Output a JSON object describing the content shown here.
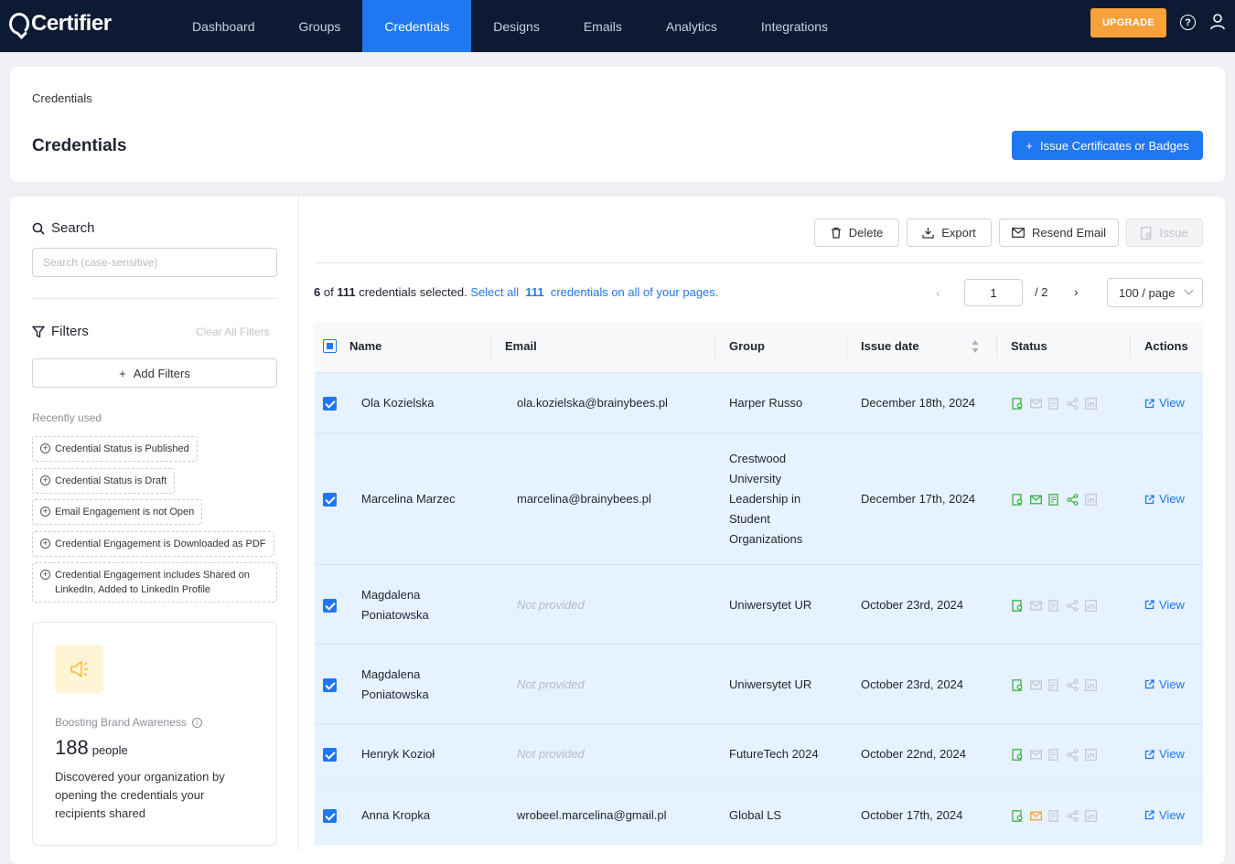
{
  "app": {
    "name": "Certifier"
  },
  "nav": {
    "items": [
      "Dashboard",
      "Groups",
      "Credentials",
      "Designs",
      "Emails",
      "Analytics",
      "Integrations"
    ],
    "active": "Credentials",
    "upgrade_label": "UPGRADE"
  },
  "header": {
    "breadcrumb": "Credentials",
    "title": "Credentials",
    "issue_button": "Issue Certificates or Badges"
  },
  "sidebar": {
    "search_title": "Search",
    "search_placeholder": "Search (case-sensitive)",
    "filters_title": "Filters",
    "clear_filters": "Clear All Filters",
    "add_filters": "Add Filters",
    "recent_label": "Recently used",
    "recent_filters": [
      "Credential Status is Published",
      "Credential Status is Draft",
      "Email Engagement is not Open",
      "Credential Engagement is Downloaded as PDF",
      "Credential Engagement includes Shared on LinkedIn, Added to LinkedIn Profile"
    ],
    "promo": {
      "title": "Boosting Brand Awareness",
      "count": "188",
      "unit": "people",
      "description": "Discovered your organization by opening the credentials your recipients shared"
    }
  },
  "toolbar": {
    "delete": "Delete",
    "export": "Export",
    "resend": "Resend Email",
    "issue": "Issue"
  },
  "selection": {
    "selected": "6",
    "of": "of",
    "total": "111",
    "suffix": "credentials selected.",
    "select_all": "Select all",
    "all_count": "111",
    "all_suffix": "credentials on all of your pages."
  },
  "pagination": {
    "current": "1",
    "total": "/  2",
    "page_size": "100 / page"
  },
  "table": {
    "columns": [
      "Name",
      "Email",
      "Group",
      "Issue date",
      "Status",
      "Actions"
    ],
    "view_label": "View",
    "rows": [
      {
        "name": "Ola Kozielska",
        "email": "ola.kozielska@brainybees.pl",
        "group": "Harper Russo",
        "date": "December 18th, 2024",
        "email_provided": true,
        "status": [
          "green",
          "gray",
          "gray",
          "gray",
          "gray"
        ]
      },
      {
        "name": "Marcelina Marzec",
        "email": "marcelina@brainybees.pl",
        "group": "Crestwood University Leadership in Student Organizations",
        "date": "December 17th, 2024",
        "email_provided": true,
        "status": [
          "green",
          "green",
          "green",
          "green",
          "gray"
        ]
      },
      {
        "name": "Magdalena Poniatowska",
        "email": "Not provided",
        "group": "Uniwersytet UR",
        "date": "October 23rd, 2024",
        "email_provided": false,
        "status": [
          "green",
          "gray",
          "gray",
          "gray",
          "gray"
        ]
      },
      {
        "name": "Magdalena Poniatowska",
        "email": "Not provided",
        "group": "Uniwersytet UR",
        "date": "October 23rd, 2024",
        "email_provided": false,
        "status": [
          "green",
          "gray",
          "gray",
          "gray",
          "gray"
        ]
      },
      {
        "name": "Henryk Kozioł",
        "email": "Not provided",
        "group": "FutureTech 2024",
        "date": "October 22nd, 2024",
        "email_provided": false,
        "status": [
          "green",
          "gray",
          "gray",
          "gray",
          "gray"
        ]
      },
      {
        "name": "Anna Kropka",
        "email": "wrobeel.marcelina@gmail.pl",
        "group": "Global LS",
        "date": "October 17th, 2024",
        "email_provided": true,
        "status": [
          "green",
          "orange",
          "gray",
          "gray",
          "gray"
        ]
      }
    ]
  },
  "colors": {
    "primary": "#2077f2",
    "nav_bg": "#0c1b33",
    "upgrade": "#f6a13a",
    "row_selected": "#e6f2ff",
    "status_green": "#3cb043",
    "status_orange": "#f6a13a",
    "status_gray": "#c4c8cf"
  }
}
